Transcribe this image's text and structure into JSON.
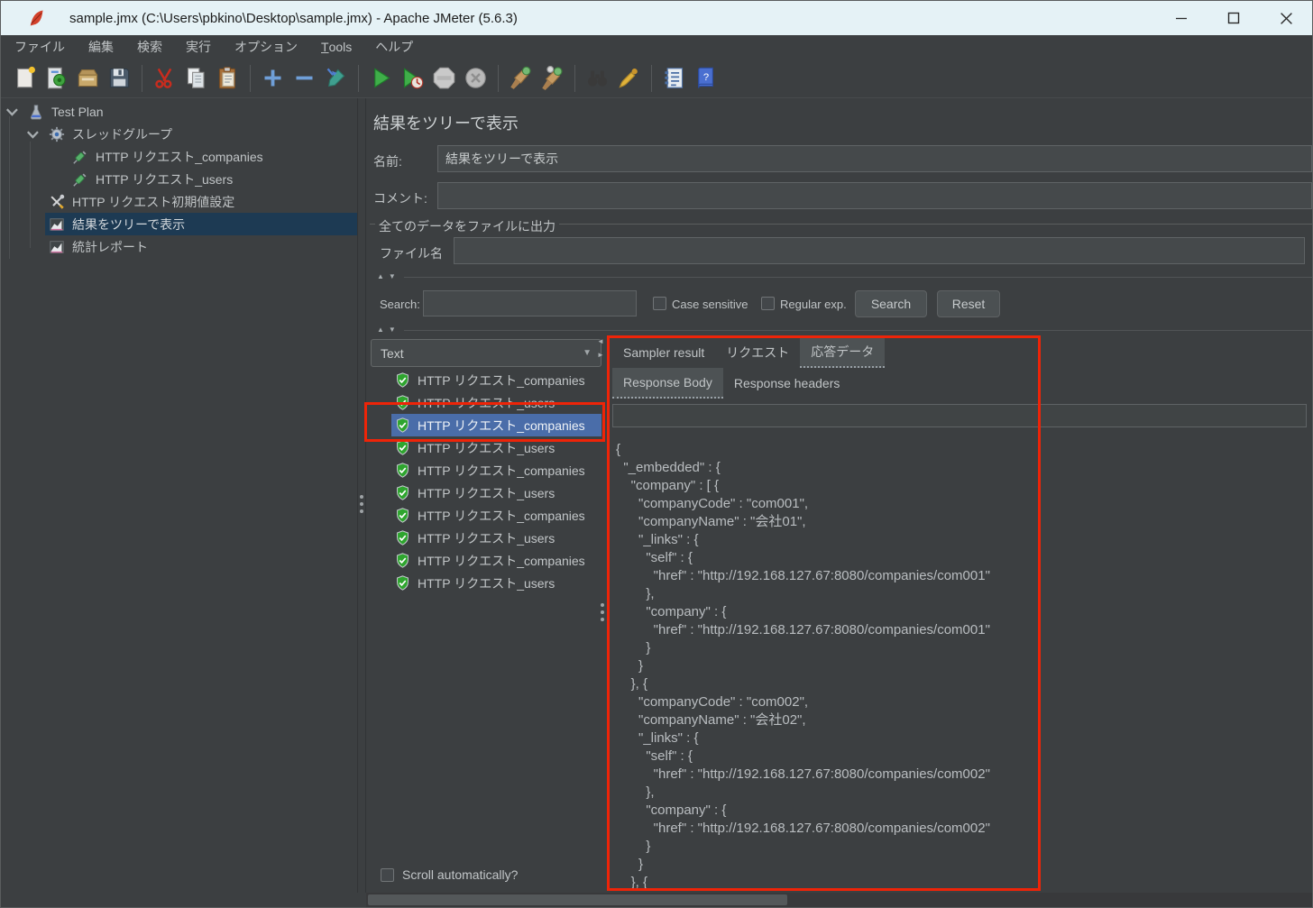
{
  "window": {
    "title": "sample.jmx (C:\\Users\\pbkino\\Desktop\\sample.jmx) - Apache JMeter (5.6.3)"
  },
  "menubar": {
    "items": [
      {
        "label": "ファイル"
      },
      {
        "label": "編集"
      },
      {
        "label": "検索"
      },
      {
        "label": "実行"
      },
      {
        "label": "オプション"
      },
      {
        "label": "Tools",
        "mnemonic": "T"
      },
      {
        "label": "ヘルプ"
      }
    ]
  },
  "toolbar": {
    "groups": [
      [
        "new-file-icon",
        "templates-icon",
        "open-file-icon",
        "save-icon"
      ],
      [
        "cut-icon",
        "copy-icon",
        "paste-icon"
      ],
      [
        "add-icon",
        "remove-icon",
        "edit-icon"
      ],
      [
        "start-icon",
        "start-no-pauses-icon",
        "stop-icon",
        "shutdown-icon"
      ],
      [
        "clear-icon",
        "clear-all-icon"
      ],
      [
        "search-icon",
        "clear-search-icon"
      ],
      [
        "function-helper-icon",
        "help-icon"
      ]
    ]
  },
  "tree": {
    "items": [
      {
        "label": "Test Plan",
        "icon": "test-plan-icon",
        "level": 0,
        "expander": true,
        "selected": false
      },
      {
        "label": "スレッドグループ",
        "icon": "thread-group-icon",
        "level": 1,
        "expander": true,
        "selected": false
      },
      {
        "label": "HTTP リクエスト_companies",
        "icon": "http-request-icon",
        "level": 2,
        "expander": false,
        "selected": false
      },
      {
        "label": "HTTP リクエスト_users",
        "icon": "http-request-icon",
        "level": 2,
        "expander": false,
        "selected": false
      },
      {
        "label": "HTTP リクエスト初期値設定",
        "icon": "http-defaults-icon",
        "level": 1,
        "expander": false,
        "selected": false
      },
      {
        "label": "結果をツリーで表示",
        "icon": "view-results-tree-icon",
        "level": 1,
        "expander": false,
        "selected": true
      },
      {
        "label": "統計レポート",
        "icon": "summary-report-icon",
        "level": 1,
        "expander": false,
        "selected": false
      }
    ]
  },
  "editor": {
    "panel_title": "結果をツリーで表示",
    "name_label": "名前:",
    "name_value": "結果をツリーで表示",
    "comment_label": "コメント:",
    "comment_value": "",
    "output_group_label": "全てのデータをファイルに出力",
    "filename_label": "ファイル名",
    "filename_value": ""
  },
  "search_bar": {
    "label": "Search:",
    "value": "",
    "case_sensitive_label": "Case sensitive",
    "regexp_label": "Regular exp.",
    "search_button": "Search",
    "reset_button": "Reset"
  },
  "results_list": {
    "view_mode": "Text",
    "items": [
      {
        "label": "HTTP リクエスト_companies",
        "selected": false
      },
      {
        "label": "HTTP リクエスト_users",
        "selected": false
      },
      {
        "label": "HTTP リクエスト_companies",
        "selected": true
      },
      {
        "label": "HTTP リクエスト_users",
        "selected": false
      },
      {
        "label": "HTTP リクエスト_companies",
        "selected": false
      },
      {
        "label": "HTTP リクエスト_users",
        "selected": false
      },
      {
        "label": "HTTP リクエスト_companies",
        "selected": false
      },
      {
        "label": "HTTP リクエスト_users",
        "selected": false
      },
      {
        "label": "HTTP リクエスト_companies",
        "selected": false
      },
      {
        "label": "HTTP リクエスト_users",
        "selected": false
      }
    ],
    "autoscroll_label": "Scroll automatically?"
  },
  "response_panel": {
    "tabs": [
      {
        "label": "Sampler result",
        "active": false
      },
      {
        "label": "リクエスト",
        "active": false
      },
      {
        "label": "応答データ",
        "active": true
      }
    ],
    "subtabs": [
      {
        "label": "Response Body",
        "active": true
      },
      {
        "label": "Response headers",
        "active": false
      }
    ],
    "search_value": "",
    "body_lines": [
      "{",
      "  \"_embedded\" : {",
      "    \"company\" : [ {",
      "      \"companyCode\" : \"com001\",",
      "      \"companyName\" : \"会社01\",",
      "      \"_links\" : {",
      "        \"self\" : {",
      "          \"href\" : \"http://192.168.127.67:8080/companies/com001\"",
      "        },",
      "        \"company\" : {",
      "          \"href\" : \"http://192.168.127.67:8080/companies/com001\"",
      "        }",
      "      }",
      "    }, {",
      "      \"companyCode\" : \"com002\",",
      "      \"companyName\" : \"会社02\",",
      "      \"_links\" : {",
      "        \"self\" : {",
      "          \"href\" : \"http://192.168.127.67:8080/companies/com002\"",
      "        },",
      "        \"company\" : {",
      "          \"href\" : \"http://192.168.127.67:8080/companies/com002\"",
      "        }",
      "      }",
      "    }, {"
    ]
  },
  "annotations": {
    "color": "#ee2408"
  }
}
